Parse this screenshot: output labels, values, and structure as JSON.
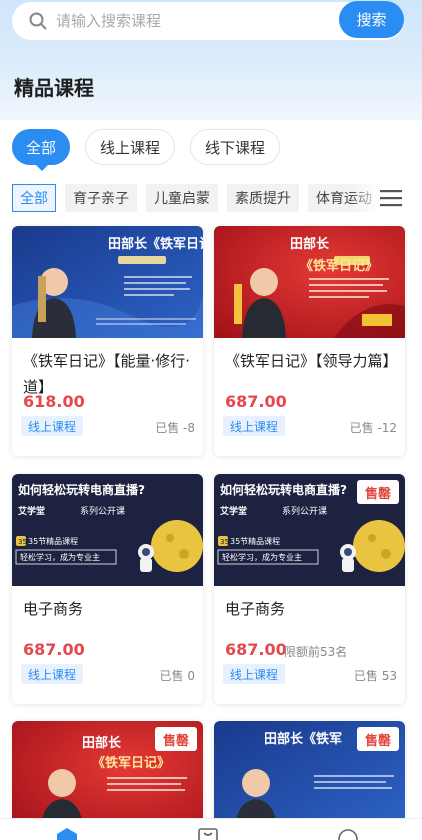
{
  "search": {
    "placeholder": "请输入搜索课程",
    "button_label": "搜索"
  },
  "section": {
    "title": "精品课程"
  },
  "main_tabs": [
    {
      "label": "全部",
      "active": true
    },
    {
      "label": "线上课程",
      "active": false
    },
    {
      "label": "线下课程",
      "active": false
    }
  ],
  "categories": [
    {
      "label": "全部",
      "active": true
    },
    {
      "label": "育子亲子",
      "active": false
    },
    {
      "label": "儿童启蒙",
      "active": false
    },
    {
      "label": "素质提升",
      "active": false
    },
    {
      "label": "体育运动",
      "active": false
    }
  ],
  "cards": [
    {
      "title": "《铁军日记》【能量·修行·道】",
      "price": "618.00",
      "price_note": "",
      "tag": "线上课程",
      "sold": "已售 -8",
      "badge": "",
      "thumb": {
        "headline": "田部长《铁军日记》",
        "theme": "blue"
      }
    },
    {
      "title": "《铁军日记》【领导力篇】",
      "price": "687.00",
      "price_note": "",
      "tag": "线上课程",
      "sold": "已售 -12",
      "badge": "",
      "thumb": {
        "headline": "田部长",
        "headline2": "《铁军日记》",
        "theme": "red"
      }
    },
    {
      "title": "电子商务",
      "price": "687.00",
      "price_note": "",
      "tag": "线上课程",
      "sold": "已售 0",
      "badge": "",
      "thumb": {
        "headline": "如何轻松玩转电商直播?",
        "sub": "艾学堂",
        "sub2": "系列公开课",
        "line1": "35节精品课程",
        "line2": "轻松学习，成为专业主",
        "theme": "dark"
      }
    },
    {
      "title": "电子商务",
      "price": "687.00",
      "price_note": "限额前53名",
      "tag": "线上课程",
      "sold": "已售 53",
      "badge": "售罄",
      "thumb": {
        "headline": "如何轻松玩转电商直播?",
        "sub": "艾学堂",
        "sub2": "系列公开课",
        "line1": "35节精品课程",
        "line2": "轻松学习，成为专业主",
        "theme": "dark"
      }
    },
    {
      "title": "",
      "price": "",
      "price_note": "",
      "tag": "",
      "sold": "",
      "badge": "售罄",
      "thumb": {
        "headline": "田部长",
        "headline2": "《铁军日记》",
        "theme": "red"
      }
    },
    {
      "title": "",
      "price": "",
      "price_note": "",
      "tag": "",
      "sold": "",
      "badge": "售罄",
      "thumb": {
        "headline": "田部长《铁军",
        "theme": "blue"
      }
    }
  ],
  "colors": {
    "accent": "#2b8cf2",
    "price": "#e5484d",
    "badge": "#e2463d"
  },
  "bottom_nav": {
    "icons": [
      "home-icon",
      "shop-icon",
      "user-icon"
    ]
  }
}
